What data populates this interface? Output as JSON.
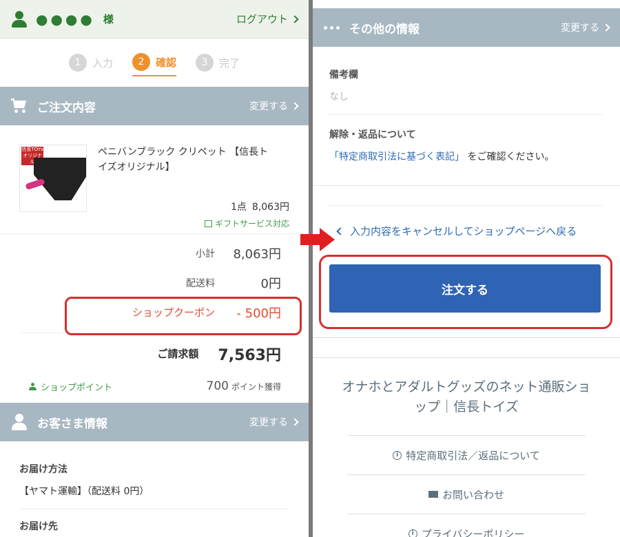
{
  "user": {
    "name_masked": "●●●●",
    "honorific": "様",
    "logout": "ログアウト"
  },
  "steps": [
    {
      "num": "1",
      "label": "入力",
      "active": false
    },
    {
      "num": "2",
      "label": "確認",
      "active": true
    },
    {
      "num": "3",
      "label": "完了",
      "active": false
    }
  ],
  "order_section": {
    "title": "ご注文内容",
    "change": "変更する"
  },
  "product": {
    "thumb_tag": "信長TOYs オリジナル",
    "name": "ペニバンブラック クリペット 【信長トイズオリジナル】",
    "qty": "1点",
    "price": "8,063円",
    "gift": "ギフトサービス対応"
  },
  "totals": {
    "subtotal_label": "小計",
    "subtotal": "8,063円",
    "shipping_label": "配送料",
    "shipping": "0円",
    "coupon_label": "ショップクーポン",
    "coupon": "- 500円",
    "grand_label": "ご請求額",
    "grand": "7,563円",
    "points_label": "ショップポイント",
    "points_value": "700",
    "points_unit": "ポイント獲得"
  },
  "customer_section": {
    "title": "お客さま情報",
    "change": "変更する",
    "delivery_label": "お届け方法",
    "delivery_value": "【ヤマト運輸】（配送料 0円）",
    "dest_label": "お届け先"
  },
  "other_section": {
    "title": "その他の情報",
    "change": "変更する"
  },
  "remarks": {
    "label": "備考欄",
    "value": "なし"
  },
  "returns": {
    "label": "解除・返品について",
    "link": "「特定商取引法に基づく表記」",
    "suffix": "をご確認ください。"
  },
  "cancel_link": "入力内容をキャンセルしてショップページへ戻る",
  "order_button": "注文する",
  "footer": {
    "shop_name": "オナホとアダルトグッズのネット通販ショップ｜信長トイズ",
    "links": [
      "特定商取引法／返品について",
      "お問い合わせ",
      "プライバシーポリシー"
    ]
  },
  "colors": {
    "accent_green": "#2e7d32",
    "step_orange": "#f0902a",
    "header_gray": "#a7b8c3",
    "order_blue": "#2f63b4",
    "highlight_red": "#d62e2e"
  }
}
